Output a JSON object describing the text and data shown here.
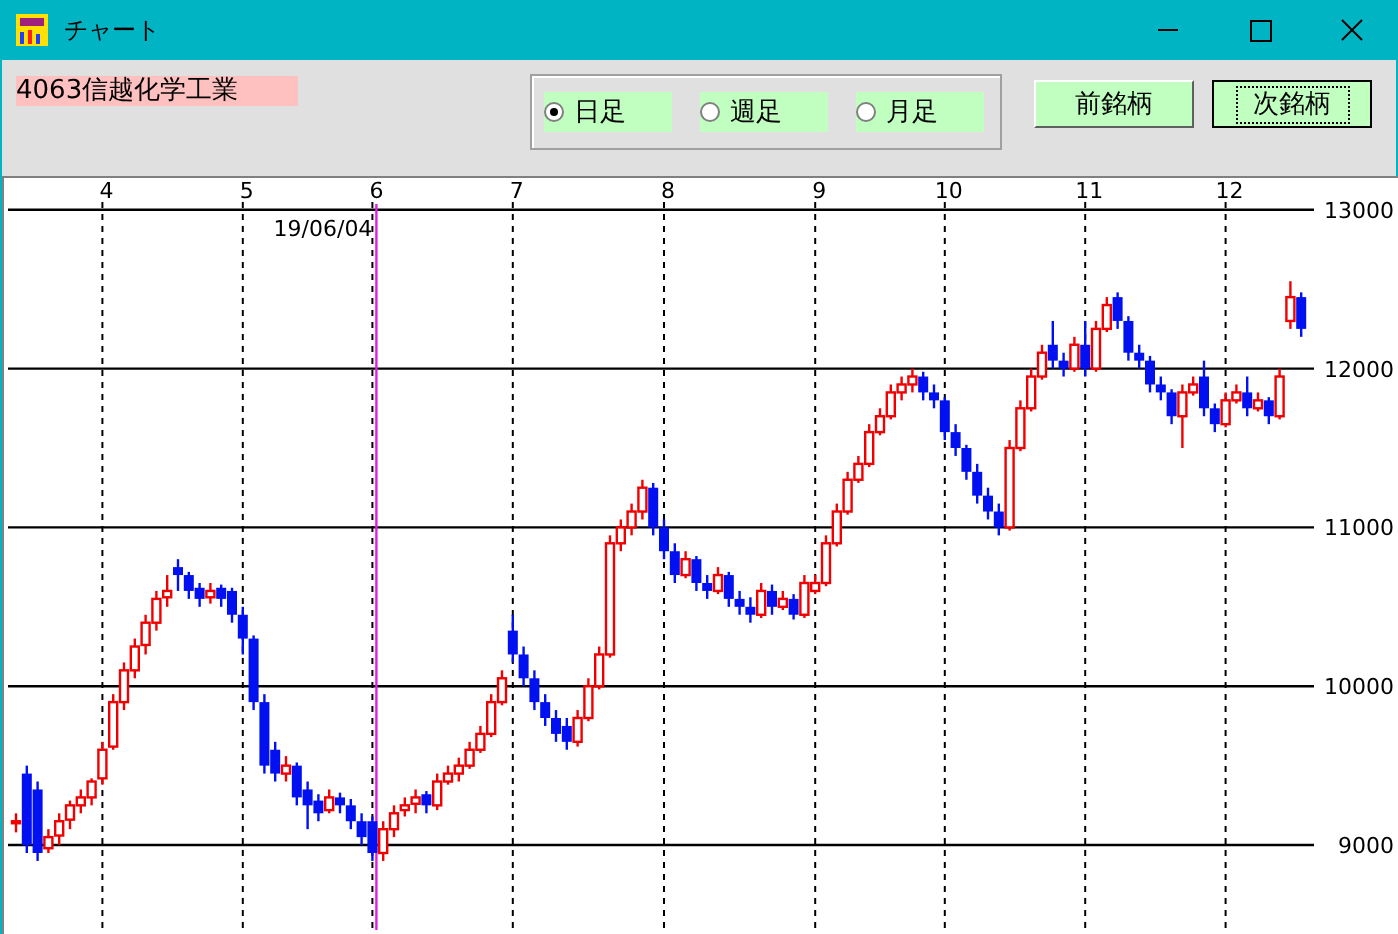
{
  "window": {
    "title": "チャート"
  },
  "stock": {
    "name": "4063信越化学工業"
  },
  "period_options": [
    {
      "label": "日足",
      "selected": true
    },
    {
      "label": "週足",
      "selected": false
    },
    {
      "label": "月足",
      "selected": false
    }
  ],
  "buttons": [
    {
      "label": "前銘柄",
      "focused": false
    },
    {
      "label": "次銘柄",
      "focused": true
    }
  ],
  "chart": {
    "chart_data": {
      "type": "candlestick",
      "categories": [
        null,
        null,
        null,
        null,
        null,
        null,
        null,
        null,
        "4",
        null,
        null,
        null,
        null,
        null,
        null,
        null,
        null,
        null,
        null,
        null,
        null,
        "5",
        null,
        null,
        null,
        null,
        null,
        null,
        null,
        null,
        null,
        null,
        null,
        "6",
        null,
        null,
        null,
        null,
        null,
        null,
        null,
        null,
        null,
        null,
        null,
        null,
        "7",
        null,
        null,
        null,
        null,
        null,
        null,
        null,
        null,
        null,
        null,
        null,
        null,
        null,
        "8",
        null,
        null,
        null,
        null,
        null,
        null,
        null,
        null,
        null,
        null,
        null,
        null,
        null,
        "9",
        null,
        null,
        null,
        null,
        null,
        null,
        null,
        null,
        null,
        null,
        null,
        "10",
        null,
        null,
        null,
        null,
        null,
        null,
        null,
        null,
        null,
        null,
        null,
        null,
        "11",
        null,
        null,
        null,
        null,
        null,
        null,
        null,
        null,
        null,
        null,
        null,
        null,
        "12",
        null,
        null,
        null,
        null,
        null,
        null,
        null
      ],
      "ylim": [
        8440,
        13200
      ],
      "ohlc": [
        [
          9140,
          9200,
          9080,
          9150
        ],
        [
          9450,
          9500,
          8950,
          9000
        ],
        [
          9350,
          9400,
          8900,
          8950
        ],
        [
          8980,
          9100,
          8950,
          9050
        ],
        [
          9060,
          9200,
          9000,
          9150
        ],
        [
          9160,
          9280,
          9100,
          9250
        ],
        [
          9250,
          9350,
          9200,
          9300
        ],
        [
          9300,
          9420,
          9250,
          9400
        ],
        [
          9420,
          9650,
          9380,
          9600
        ],
        [
          9620,
          9950,
          9600,
          9900
        ],
        [
          9900,
          10150,
          9850,
          10100
        ],
        [
          10100,
          10300,
          10050,
          10250
        ],
        [
          10260,
          10450,
          10200,
          10400
        ],
        [
          10400,
          10600,
          10350,
          10550
        ],
        [
          10560,
          10700,
          10500,
          10600
        ],
        [
          10750,
          10800,
          10600,
          10700
        ],
        [
          10700,
          10720,
          10550,
          10600
        ],
        [
          10620,
          10650,
          10500,
          10550
        ],
        [
          10560,
          10650,
          10520,
          10600
        ],
        [
          10620,
          10640,
          10500,
          10550
        ],
        [
          10600,
          10620,
          10400,
          10450
        ],
        [
          10450,
          10500,
          10200,
          10300
        ],
        [
          10300,
          10320,
          9850,
          9900
        ],
        [
          9900,
          9950,
          9450,
          9500
        ],
        [
          9600,
          9650,
          9400,
          9450
        ],
        [
          9450,
          9560,
          9400,
          9500
        ],
        [
          9500,
          9520,
          9250,
          9300
        ],
        [
          9350,
          9400,
          9100,
          9250
        ],
        [
          9280,
          9320,
          9150,
          9200
        ],
        [
          9220,
          9350,
          9200,
          9300
        ],
        [
          9300,
          9330,
          9200,
          9250
        ],
        [
          9250,
          9290,
          9100,
          9150
        ],
        [
          9150,
          9200,
          9000,
          9050
        ],
        [
          9150,
          9180,
          8900,
          8950
        ],
        [
          8950,
          9150,
          8900,
          9100
        ],
        [
          9100,
          9250,
          9050,
          9200
        ],
        [
          9220,
          9300,
          9180,
          9250
        ],
        [
          9260,
          9350,
          9200,
          9300
        ],
        [
          9320,
          9340,
          9200,
          9250
        ],
        [
          9250,
          9450,
          9220,
          9400
        ],
        [
          9400,
          9500,
          9380,
          9450
        ],
        [
          9450,
          9550,
          9400,
          9500
        ],
        [
          9500,
          9650,
          9480,
          9600
        ],
        [
          9600,
          9750,
          9580,
          9700
        ],
        [
          9700,
          9950,
          9680,
          9900
        ],
        [
          9900,
          10100,
          9880,
          10050
        ],
        [
          10350,
          10450,
          10150,
          10200
        ],
        [
          10200,
          10250,
          10000,
          10050
        ],
        [
          10050,
          10100,
          9850,
          9900
        ],
        [
          9900,
          9950,
          9750,
          9800
        ],
        [
          9800,
          9850,
          9650,
          9700
        ],
        [
          9750,
          9800,
          9600,
          9650
        ],
        [
          9650,
          9850,
          9620,
          9800
        ],
        [
          9800,
          10050,
          9780,
          10000
        ],
        [
          10000,
          10250,
          9980,
          10200
        ],
        [
          10200,
          10950,
          10180,
          10900
        ],
        [
          10900,
          11050,
          10850,
          11000
        ],
        [
          11000,
          11150,
          10950,
          11100
        ],
        [
          11100,
          11300,
          11050,
          11250
        ],
        [
          11250,
          11280,
          10950,
          11000
        ],
        [
          11000,
          11050,
          10800,
          10850
        ],
        [
          10850,
          10900,
          10650,
          10700
        ],
        [
          10700,
          10850,
          10680,
          10800
        ],
        [
          10800,
          10820,
          10600,
          10650
        ],
        [
          10650,
          10700,
          10550,
          10600
        ],
        [
          10600,
          10750,
          10580,
          10700
        ],
        [
          10700,
          10720,
          10500,
          10550
        ],
        [
          10550,
          10600,
          10450,
          10500
        ],
        [
          10500,
          10560,
          10400,
          10450
        ],
        [
          10450,
          10650,
          10430,
          10600
        ],
        [
          10600,
          10640,
          10450,
          10500
        ],
        [
          10500,
          10600,
          10480,
          10550
        ],
        [
          10550,
          10580,
          10420,
          10450
        ],
        [
          10450,
          10700,
          10430,
          10650
        ],
        [
          10600,
          10700,
          10580,
          10650
        ],
        [
          10650,
          10950,
          10630,
          10900
        ],
        [
          10900,
          11150,
          10880,
          11100
        ],
        [
          11100,
          11350,
          11080,
          11300
        ],
        [
          11300,
          11450,
          11280,
          11400
        ],
        [
          11400,
          11650,
          11380,
          11600
        ],
        [
          11600,
          11750,
          11580,
          11700
        ],
        [
          11700,
          11900,
          11680,
          11850
        ],
        [
          11850,
          11950,
          11800,
          11900
        ],
        [
          11900,
          12000,
          11850,
          11950
        ],
        [
          11950,
          11980,
          11800,
          11850
        ],
        [
          11850,
          11900,
          11750,
          11800
        ],
        [
          11800,
          11820,
          11550,
          11600
        ],
        [
          11600,
          11650,
          11450,
          11500
        ],
        [
          11500,
          11520,
          11300,
          11350
        ],
        [
          11350,
          11400,
          11150,
          11200
        ],
        [
          11200,
          11250,
          11050,
          11100
        ],
        [
          11100,
          11150,
          10950,
          11000
        ],
        [
          11000,
          11550,
          10980,
          11500
        ],
        [
          11500,
          11800,
          11480,
          11750
        ],
        [
          11750,
          12000,
          11730,
          11950
        ],
        [
          11950,
          12150,
          11930,
          12100
        ],
        [
          12150,
          12300,
          12000,
          12050
        ],
        [
          12050,
          12100,
          11950,
          12000
        ],
        [
          12000,
          12200,
          11980,
          12150
        ],
        [
          12150,
          12300,
          11950,
          12000
        ],
        [
          12000,
          12300,
          11980,
          12250
        ],
        [
          12250,
          12450,
          12230,
          12400
        ],
        [
          12450,
          12480,
          12250,
          12300
        ],
        [
          12300,
          12330,
          12050,
          12100
        ],
        [
          12100,
          12150,
          12000,
          12050
        ],
        [
          12050,
          12080,
          11850,
          11900
        ],
        [
          11900,
          11950,
          11800,
          11850
        ],
        [
          11850,
          11870,
          11650,
          11700
        ],
        [
          11700,
          11900,
          11500,
          11850
        ],
        [
          11850,
          11950,
          11830,
          11900
        ],
        [
          11950,
          12050,
          11700,
          11750
        ],
        [
          11750,
          11780,
          11600,
          11650
        ],
        [
          11650,
          11850,
          11630,
          11800
        ],
        [
          11800,
          11900,
          11780,
          11850
        ],
        [
          11850,
          11950,
          11700,
          11750
        ],
        [
          11750,
          11850,
          11730,
          11800
        ],
        [
          11800,
          11820,
          11650,
          11700
        ],
        [
          11700,
          12000,
          11680,
          11950
        ],
        [
          12300,
          12550,
          12250,
          12450
        ],
        [
          12450,
          12480,
          12200,
          12250
        ]
      ],
      "yticks": [
        13000,
        12000,
        11000,
        10000,
        9000
      ],
      "grid": true,
      "annotations": [
        "19/06/04"
      ]
    }
  }
}
